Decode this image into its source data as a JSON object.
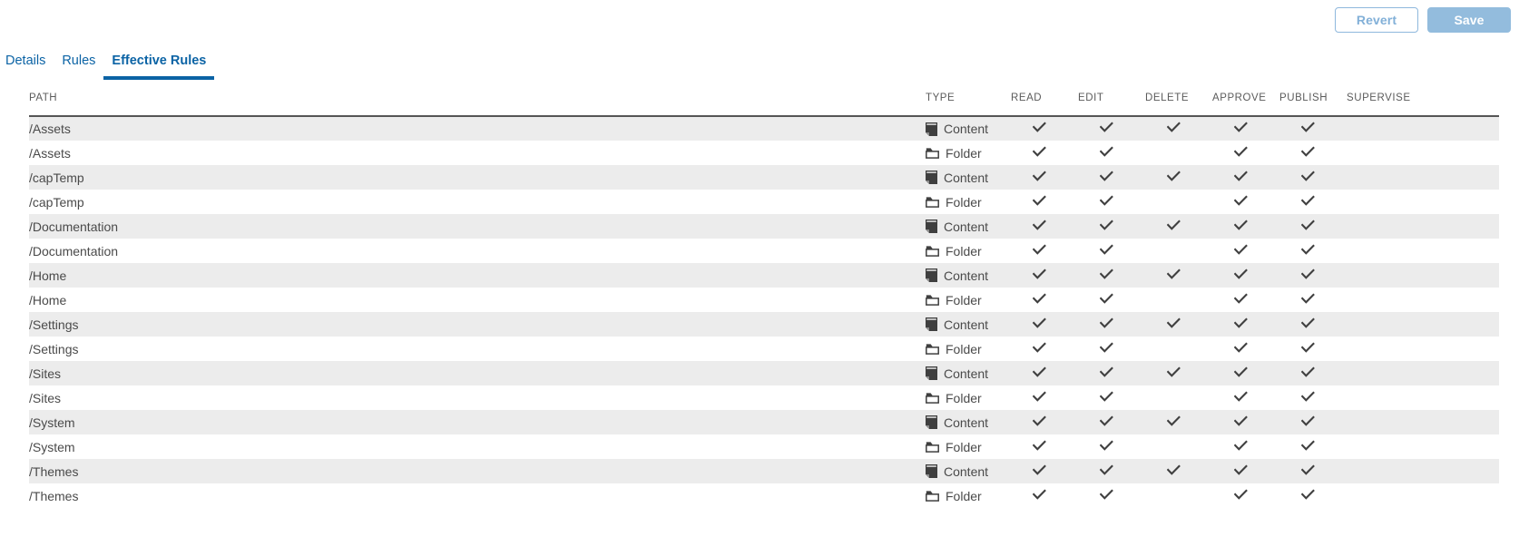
{
  "toolbar": {
    "revert_label": "Revert",
    "save_label": "Save"
  },
  "tabs": [
    {
      "label": "Details",
      "active": false
    },
    {
      "label": "Rules",
      "active": false
    },
    {
      "label": "Effective Rules",
      "active": true
    }
  ],
  "colors": {
    "accent": "#0b63a5",
    "button_disabled": "#93bcdd",
    "row_stripe": "#ececec",
    "icon": "#3c3c3c",
    "header_text": "#5b5b5b"
  },
  "table": {
    "columns": [
      {
        "key": "path",
        "label": "PATH"
      },
      {
        "key": "type",
        "label": "TYPE"
      },
      {
        "key": "read",
        "label": "READ"
      },
      {
        "key": "edit",
        "label": "EDIT"
      },
      {
        "key": "delete",
        "label": "DELETE"
      },
      {
        "key": "approve",
        "label": "APPROVE"
      },
      {
        "key": "publish",
        "label": "PUBLISH"
      },
      {
        "key": "supervise",
        "label": "SUPERVISE"
      }
    ],
    "rows": [
      {
        "path": "/Assets",
        "type": "Content",
        "type_icon": "content-icon",
        "read": true,
        "edit": true,
        "delete": true,
        "approve": true,
        "publish": true,
        "supervise": false
      },
      {
        "path": "/Assets",
        "type": "Folder",
        "type_icon": "folder-icon",
        "read": true,
        "edit": true,
        "delete": false,
        "approve": true,
        "publish": true,
        "supervise": false
      },
      {
        "path": "/capTemp",
        "type": "Content",
        "type_icon": "content-icon",
        "read": true,
        "edit": true,
        "delete": true,
        "approve": true,
        "publish": true,
        "supervise": false
      },
      {
        "path": "/capTemp",
        "type": "Folder",
        "type_icon": "folder-icon",
        "read": true,
        "edit": true,
        "delete": false,
        "approve": true,
        "publish": true,
        "supervise": false
      },
      {
        "path": "/Documentation",
        "type": "Content",
        "type_icon": "content-icon",
        "read": true,
        "edit": true,
        "delete": true,
        "approve": true,
        "publish": true,
        "supervise": false
      },
      {
        "path": "/Documentation",
        "type": "Folder",
        "type_icon": "folder-icon",
        "read": true,
        "edit": true,
        "delete": false,
        "approve": true,
        "publish": true,
        "supervise": false
      },
      {
        "path": "/Home",
        "type": "Content",
        "type_icon": "content-icon",
        "read": true,
        "edit": true,
        "delete": true,
        "approve": true,
        "publish": true,
        "supervise": false
      },
      {
        "path": "/Home",
        "type": "Folder",
        "type_icon": "folder-icon",
        "read": true,
        "edit": true,
        "delete": false,
        "approve": true,
        "publish": true,
        "supervise": false
      },
      {
        "path": "/Settings",
        "type": "Content",
        "type_icon": "content-icon",
        "read": true,
        "edit": true,
        "delete": true,
        "approve": true,
        "publish": true,
        "supervise": false
      },
      {
        "path": "/Settings",
        "type": "Folder",
        "type_icon": "folder-icon",
        "read": true,
        "edit": true,
        "delete": false,
        "approve": true,
        "publish": true,
        "supervise": false
      },
      {
        "path": "/Sites",
        "type": "Content",
        "type_icon": "content-icon",
        "read": true,
        "edit": true,
        "delete": true,
        "approve": true,
        "publish": true,
        "supervise": false
      },
      {
        "path": "/Sites",
        "type": "Folder",
        "type_icon": "folder-icon",
        "read": true,
        "edit": true,
        "delete": false,
        "approve": true,
        "publish": true,
        "supervise": false
      },
      {
        "path": "/System",
        "type": "Content",
        "type_icon": "content-icon",
        "read": true,
        "edit": true,
        "delete": true,
        "approve": true,
        "publish": true,
        "supervise": false
      },
      {
        "path": "/System",
        "type": "Folder",
        "type_icon": "folder-icon",
        "read": true,
        "edit": true,
        "delete": false,
        "approve": true,
        "publish": true,
        "supervise": false
      },
      {
        "path": "/Themes",
        "type": "Content",
        "type_icon": "content-icon",
        "read": true,
        "edit": true,
        "delete": true,
        "approve": true,
        "publish": true,
        "supervise": false
      },
      {
        "path": "/Themes",
        "type": "Folder",
        "type_icon": "folder-icon",
        "read": true,
        "edit": true,
        "delete": false,
        "approve": true,
        "publish": true,
        "supervise": false
      }
    ]
  }
}
